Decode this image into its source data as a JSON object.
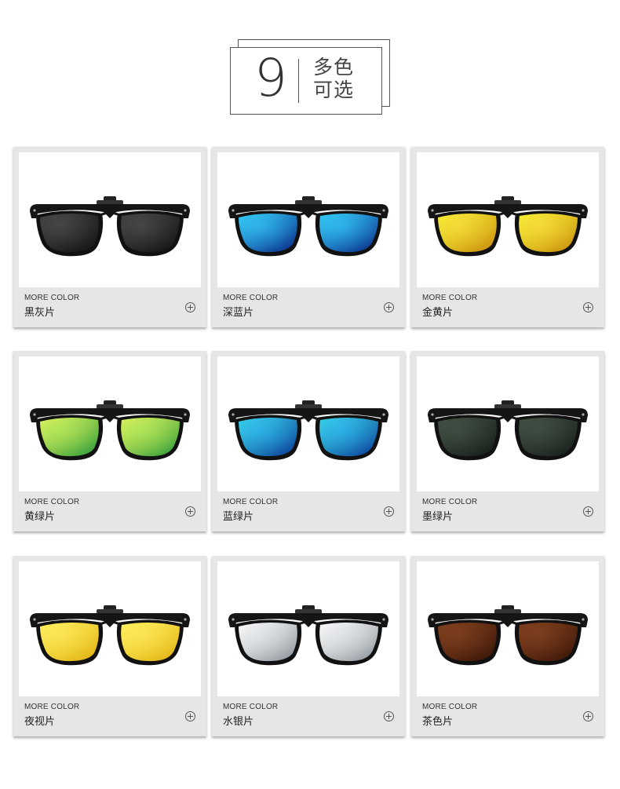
{
  "header": {
    "number": "9",
    "line1": "多色",
    "line2": "可选"
  },
  "more_label": "MORE COLOR",
  "items": [
    {
      "name": "黑灰片",
      "lens": [
        "#3a3a3a",
        "#141414"
      ],
      "glow": "#5a5a5a"
    },
    {
      "name": "深蓝片",
      "lens": [
        "#2fc4f0",
        "#0a2a8a"
      ],
      "glow": "#3ad0ff"
    },
    {
      "name": "金黄片",
      "lens": [
        "#f4f02a",
        "#c98a10"
      ],
      "glow": "#ffe34a"
    },
    {
      "name": "黄绿片",
      "lens": [
        "#e6f25a",
        "#2a9a3a"
      ],
      "glow": "#b8f060"
    },
    {
      "name": "蓝绿片",
      "lens": [
        "#3ad6e0",
        "#0a3a9a"
      ],
      "glow": "#30c0ff"
    },
    {
      "name": "墨绿片",
      "lens": [
        "#3c4a40",
        "#161e18"
      ],
      "glow": "#4a5a4c"
    },
    {
      "name": "夜视片",
      "lens": [
        "#fff25a",
        "#e0b010"
      ],
      "glow": "#ffe860"
    },
    {
      "name": "水银片",
      "lens": [
        "#ffffff",
        "#8a9298"
      ],
      "glow": "#e8ecef"
    },
    {
      "name": "茶色片",
      "lens": [
        "#7a3a1a",
        "#3a1608"
      ],
      "glow": "#8a4a24"
    }
  ]
}
